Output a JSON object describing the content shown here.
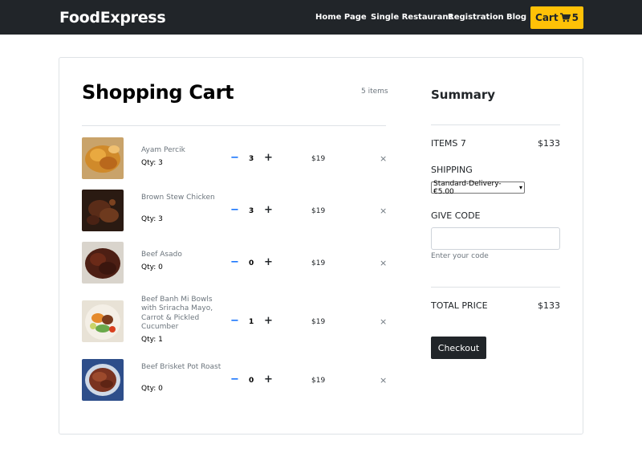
{
  "navbar": {
    "brand": "FoodExpress",
    "links": [
      "Home Page",
      "Single Restaurant",
      "Registration",
      "Blog"
    ],
    "cart_label": "Cart",
    "cart_count": "5",
    "cart_color": "#ffc107",
    "background": "#212529"
  },
  "cart": {
    "title": "Shopping Cart",
    "items_count": "5 items",
    "items": [
      {
        "name": "Ayam Percik",
        "qty_label": "Qty: 3",
        "qty": "3",
        "price": "$19",
        "minus": "−",
        "plus": "+",
        "remove": "×"
      },
      {
        "name": "Brown Stew Chicken",
        "qty_label": "Qty: 3",
        "qty": "3",
        "price": "$19",
        "minus": "−",
        "plus": "+",
        "remove": "×"
      },
      {
        "name": "Beef Asado",
        "qty_label": "Qty: 0",
        "qty": "0",
        "price": "$19",
        "minus": "−",
        "plus": "+",
        "remove": "×"
      },
      {
        "name": "Beef Banh Mi Bowls with Sriracha Mayo, Carrot & Pickled Cucumber",
        "qty_label": "Qty: 1",
        "qty": "1",
        "price": "$19",
        "minus": "−",
        "plus": "+",
        "remove": "×"
      },
      {
        "name": "Beef Brisket Pot Roast",
        "qty_label": "Qty: 0",
        "qty": "0",
        "price": "$19",
        "minus": "−",
        "plus": "+",
        "remove": "×"
      }
    ]
  },
  "summary": {
    "title": "Summary",
    "items_label": "ITEMS 7",
    "items_value": "$133",
    "shipping_label": "SHIPPING",
    "shipping_selected": "Standard-Delivery- €5.00",
    "code_label": "GIVE CODE",
    "code_value": "",
    "code_hint": "Enter your code",
    "total_label": "TOTAL PRICE",
    "total_value": "$133",
    "checkout_label": "Checkout"
  }
}
